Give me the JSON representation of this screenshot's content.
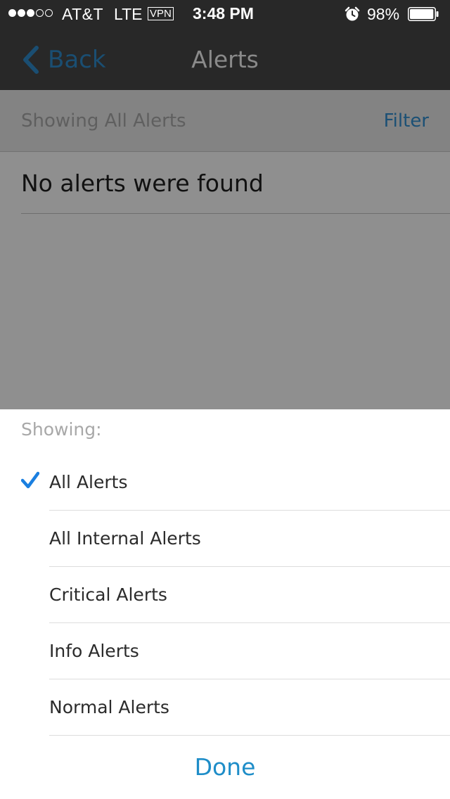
{
  "status_bar": {
    "signal_dots": [
      true,
      true,
      true,
      false,
      false
    ],
    "carrier": "AT&T",
    "network": "LTE",
    "vpn": "VPN",
    "time": "3:48 PM",
    "alarm_icon": "alarm-clock-icon",
    "battery_percent": "98%",
    "battery_level": 0.98
  },
  "nav": {
    "back_label": "Back",
    "title": "Alerts"
  },
  "filter_header": {
    "showing_label": "Showing All Alerts",
    "filter_label": "Filter"
  },
  "list": {
    "empty_message": "No alerts were found"
  },
  "sheet": {
    "title": "Showing:",
    "options": [
      {
        "label": "All Alerts",
        "selected": true
      },
      {
        "label": "All Internal Alerts",
        "selected": false
      },
      {
        "label": "Critical Alerts",
        "selected": false
      },
      {
        "label": "Info Alerts",
        "selected": false
      },
      {
        "label": "Normal Alerts",
        "selected": false
      }
    ],
    "done_label": "Done"
  },
  "colors": {
    "status_bg": "#282828",
    "dim_overlay": "#8f8f8f",
    "accent": "#1e8dc8",
    "check": "#1a7fe0",
    "back_tint": "#1a4e72"
  }
}
